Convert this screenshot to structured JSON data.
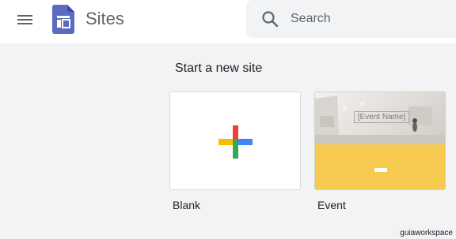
{
  "header": {
    "app_title": "Sites",
    "menu_icon": "hamburger-menu-icon",
    "logo_icon": "google-sites-logo"
  },
  "search": {
    "placeholder": "Search",
    "value": "",
    "icon": "search-icon"
  },
  "main": {
    "section_title": "Start a new site",
    "templates": [
      {
        "label": "Blank",
        "icon": "plus-icon"
      },
      {
        "label": "Event",
        "preview": {
          "event_name": "[Event Name]"
        }
      }
    ]
  },
  "watermark": "guiaworkspace",
  "colors": {
    "sites_purple": "#4285f4",
    "google_blue": "#4285f4",
    "google_red": "#ea4335",
    "google_yellow": "#fbbc04",
    "google_green": "#34a853",
    "event_yellow": "#f6cb4f"
  }
}
